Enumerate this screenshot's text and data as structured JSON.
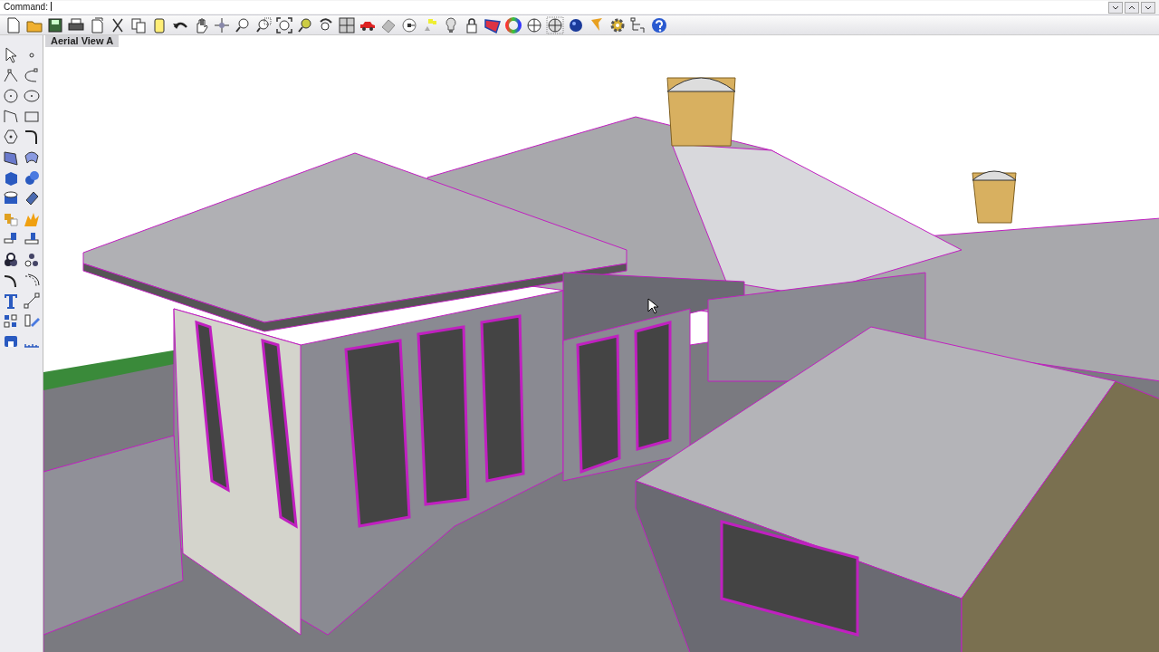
{
  "command_line": {
    "prompt": "Command:"
  },
  "viewport": {
    "title": "Aerial View A"
  }
}
